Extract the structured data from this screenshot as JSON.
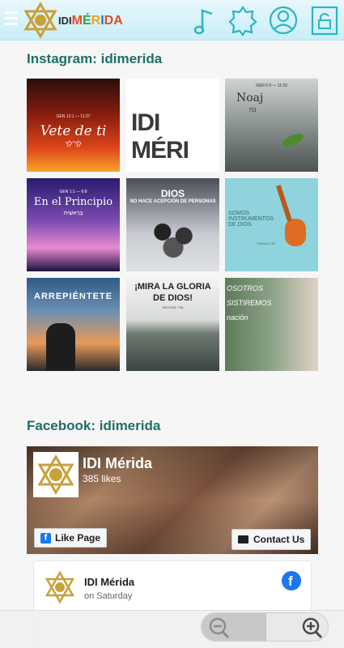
{
  "header": {
    "logo_idi": "IDI",
    "logo_letters": [
      "M",
      "É",
      "R",
      "I",
      "DA"
    ],
    "nav": [
      "menu-icon",
      "music-icon",
      "badge-icon",
      "user-icon",
      "lock-icon"
    ]
  },
  "instagram": {
    "title": "Instagram: idimerida",
    "posts": [
      {
        "ref": "GEN 12:1 — 11:27",
        "text": "Vete de ti",
        "sub": "לֶךְ־לְךָ"
      },
      {
        "text": "IDI MÉRI"
      },
      {
        "ref": "GEN 6:9 — 11:32",
        "text": "Noaj",
        "sub": "נֹחַ"
      },
      {
        "ref": "GEN 1:1 — 6:8",
        "text": "En el Principio",
        "sub": "בְּרֵאשִׁית"
      },
      {
        "text": "DIOS",
        "sub": "NO HACE ACEPCIÓN DE PERSONAS"
      },
      {
        "text": "SOMOS INSTRUMENTOS DE DIOS",
        "sub": "Efesios 2:10"
      },
      {
        "text": "ARREPIÉNTETE"
      },
      {
        "text": "¡MIRA LA GLORIA DE DIOS!",
        "sub": "HECHOS 7:55"
      },
      {
        "text": "OSOTROS SISTIREMOS nación"
      }
    ]
  },
  "facebook": {
    "title": "Facebook: idimerida",
    "page_name": "IDI Mérida",
    "likes": "385 likes",
    "like_button": "Like Page",
    "contact_button": "Contact Us",
    "post_author": "IDI Mérida",
    "post_time": "on Saturday"
  },
  "zoom": {
    "out": "zoom-out-icon",
    "in": "zoom-in-icon"
  },
  "colors": {
    "accent": "#1f6f68",
    "icon": "#29b6c6",
    "fb_blue": "#1877f2"
  }
}
